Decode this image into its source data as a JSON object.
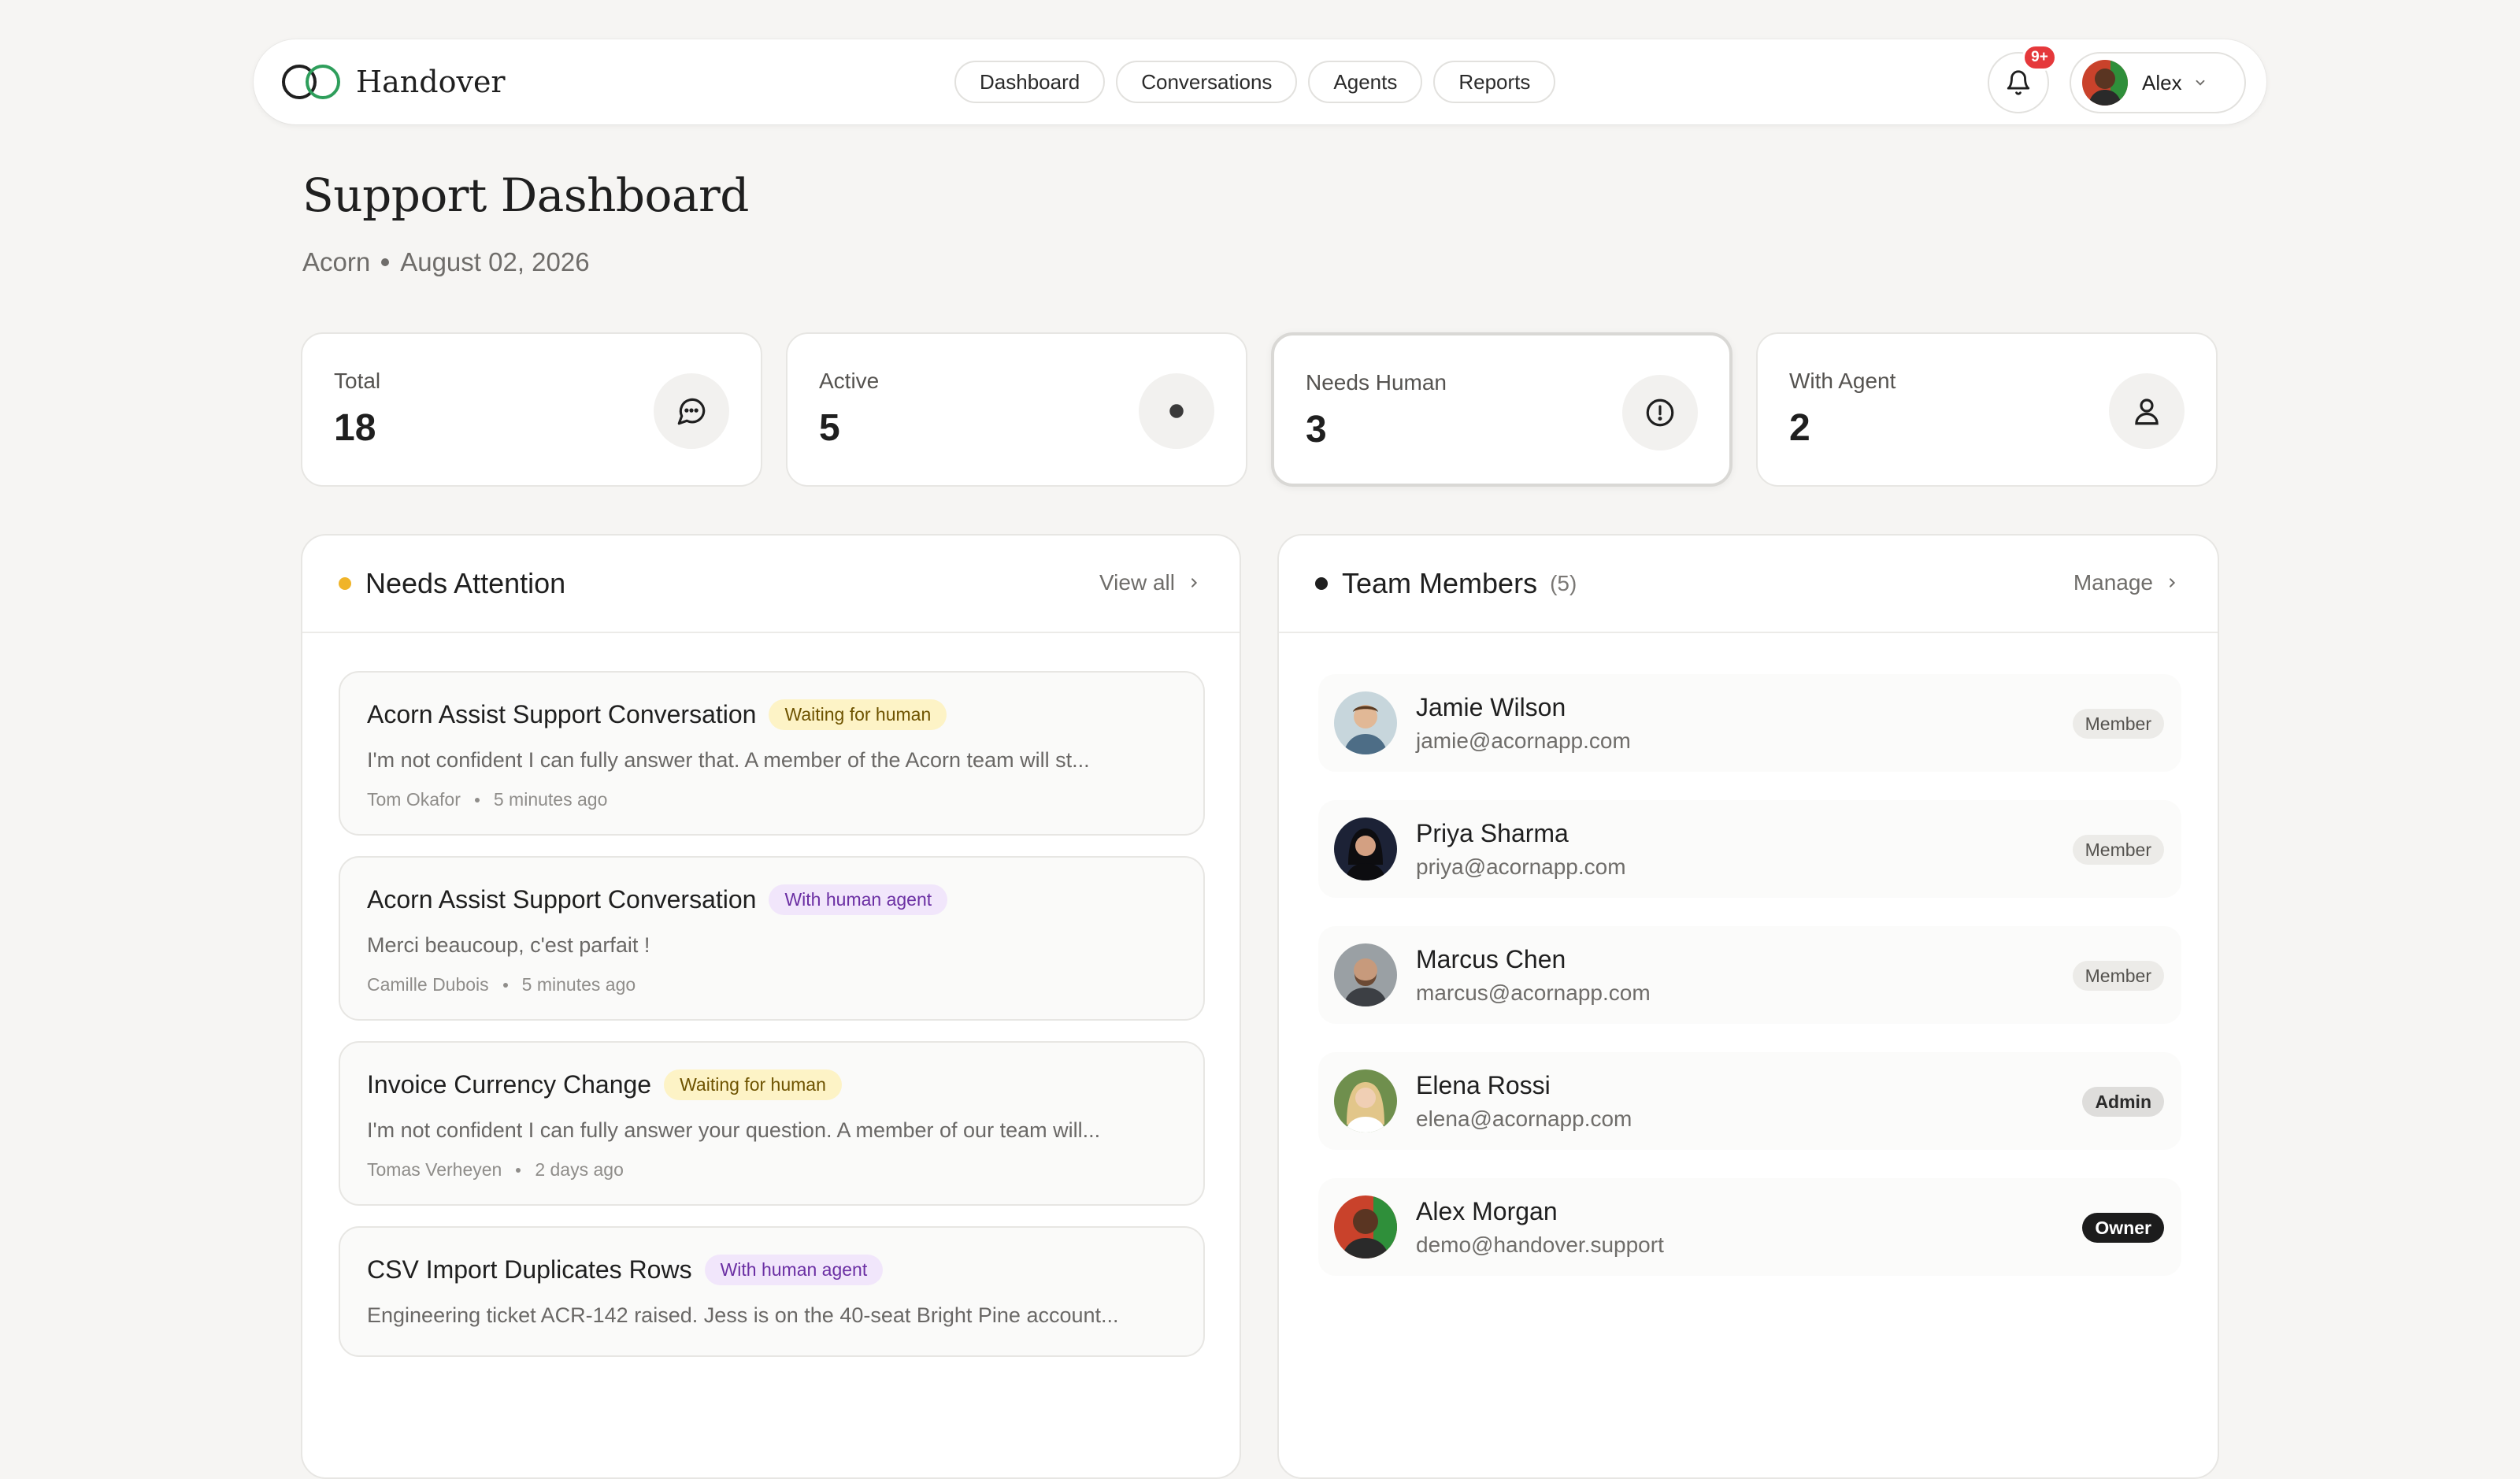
{
  "app": {
    "name": "Handover"
  },
  "nav": [
    {
      "label": "Dashboard"
    },
    {
      "label": "Conversations"
    },
    {
      "label": "Agents"
    },
    {
      "label": "Reports"
    }
  ],
  "notifications": {
    "count": "9+"
  },
  "user": {
    "name": "Alex"
  },
  "page": {
    "title": "Support Dashboard",
    "org": "Acorn",
    "date": "August 02, 2026"
  },
  "stats": [
    {
      "label": "Total",
      "value": "18",
      "icon": "chat-bubble-icon"
    },
    {
      "label": "Active",
      "value": "5",
      "icon": "active-dot-icon"
    },
    {
      "label": "Needs Human",
      "value": "3",
      "icon": "alert-circle-icon"
    },
    {
      "label": "With Agent",
      "value": "2",
      "icon": "person-icon"
    }
  ],
  "attention": {
    "title": "Needs Attention",
    "link": "View all",
    "dot_color": "#f0b429",
    "items": [
      {
        "title": "Acorn Assist Support Conversation",
        "status": "Waiting for human",
        "preview": "I'm not confident I can fully answer that. A member of the Acorn team will st...",
        "author": "Tom Okafor",
        "time": "5 minutes ago"
      },
      {
        "title": "Acorn Assist Support Conversation",
        "status": "With human agent",
        "preview": "Merci beaucoup, c'est parfait !",
        "author": "Camille Dubois",
        "time": "5 minutes ago"
      },
      {
        "title": "Invoice Currency Change",
        "status": "Waiting for human",
        "preview": "I'm not confident I can fully answer your question. A member of our team will...",
        "author": "Tomas Verheyen",
        "time": "2 days ago"
      },
      {
        "title": "CSV Import Duplicates Rows",
        "status": "With human agent",
        "preview": "Engineering ticket ACR-142 raised. Jess is on the 40-seat Bright Pine account...",
        "author": "",
        "time": ""
      }
    ]
  },
  "team": {
    "title": "Team Members",
    "count": "(5)",
    "link": "Manage",
    "members": [
      {
        "name": "Jamie Wilson",
        "email": "jamie@acornapp.com",
        "role": "Member"
      },
      {
        "name": "Priya Sharma",
        "email": "priya@acornapp.com",
        "role": "Member"
      },
      {
        "name": "Marcus Chen",
        "email": "marcus@acornapp.com",
        "role": "Member"
      },
      {
        "name": "Elena Rossi",
        "email": "elena@acornapp.com",
        "role": "Admin"
      },
      {
        "name": "Alex Morgan",
        "email": "demo@handover.support",
        "role": "Owner"
      }
    ]
  },
  "colors": {
    "accent_green": "#2e9e5b",
    "notification_red": "#e5383b",
    "waiting_bg": "#fdf3c6",
    "agent_bg": "#f1e6fb"
  }
}
